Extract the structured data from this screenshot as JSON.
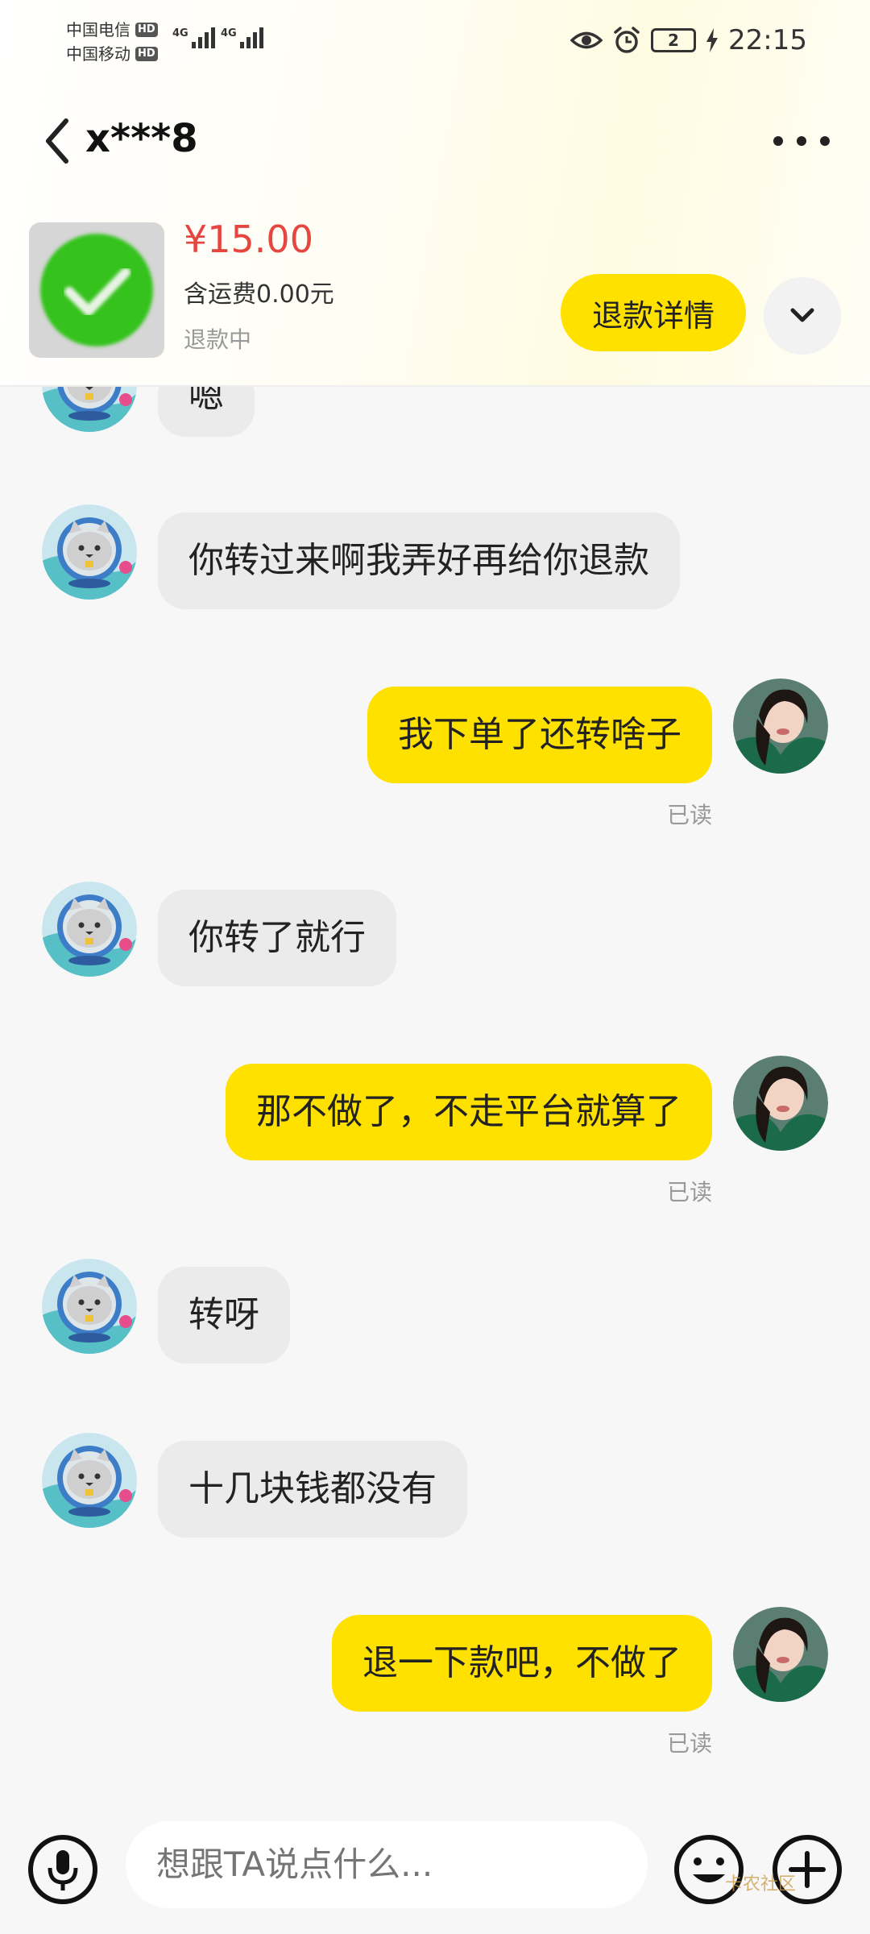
{
  "status_bar": {
    "carrier1": "中国电信",
    "carrier2": "中国移动",
    "hd": "HD",
    "net1": "4G",
    "net2": "4G",
    "battery": "2",
    "time": "22:15"
  },
  "header": {
    "title": "x***8"
  },
  "product": {
    "price": "¥15.00",
    "shipping": "含运费0.00元",
    "status": "退款中",
    "refund_button": "退款详情"
  },
  "messages": [
    {
      "side": "in",
      "text": "嗯"
    },
    {
      "side": "in",
      "text": "你转过来啊我弄好再给你退款"
    },
    {
      "side": "out",
      "text": "我下单了还转啥子",
      "read": "已读"
    },
    {
      "side": "in",
      "text": "你转了就行"
    },
    {
      "side": "out",
      "text": "那不做了，不走平台就算了",
      "read": "已读"
    },
    {
      "side": "in",
      "text": "转呀"
    },
    {
      "side": "in",
      "text": "十几块钱都没有"
    },
    {
      "side": "out",
      "text": "退一下款吧，不做了",
      "read": "已读"
    }
  ],
  "input": {
    "placeholder": "想跟TA说点什么..."
  },
  "watermark": "卡农社区",
  "colors": {
    "accent": "#ffe100",
    "price": "#e5463f",
    "incoming_bubble": "#ebebeb",
    "background": "#f7f7f7"
  },
  "icons": {
    "back": "chevron-left-icon",
    "more": "more-dots-icon",
    "expand": "chevron-down-icon",
    "mic": "mic-icon",
    "emoji": "emoji-icon",
    "plus": "plus-icon"
  }
}
